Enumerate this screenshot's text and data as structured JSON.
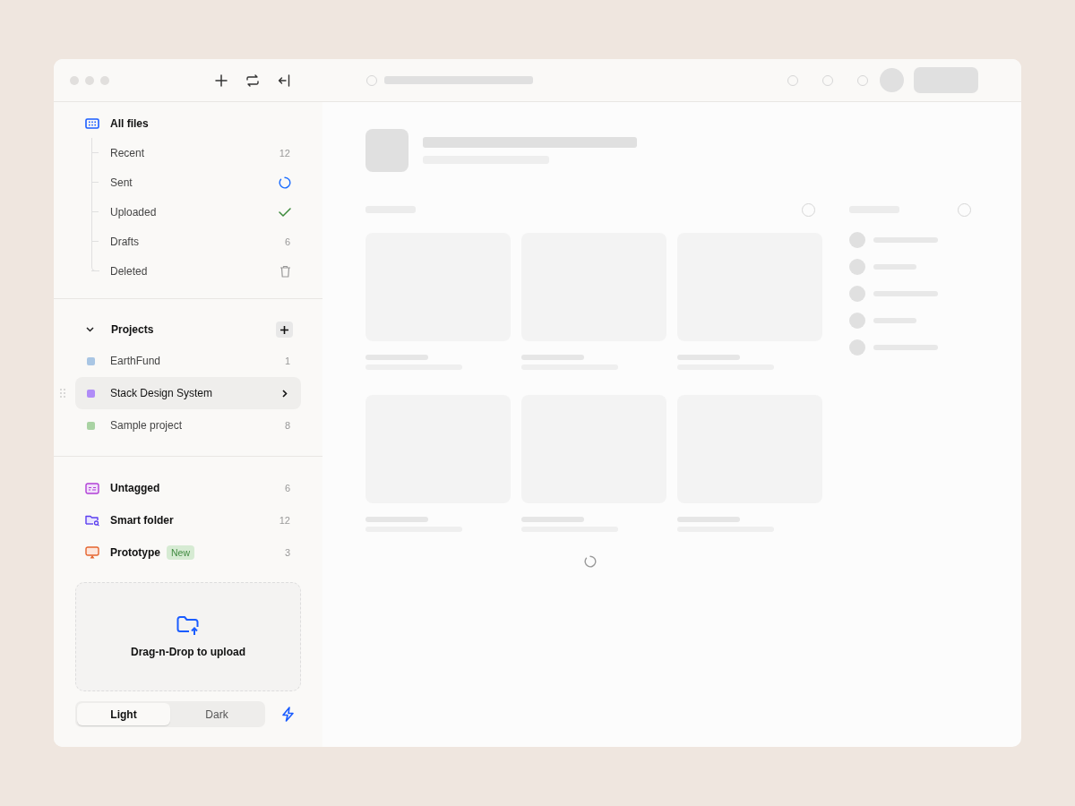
{
  "sidebar": {
    "all_files": {
      "label": "All files"
    },
    "file_items": [
      {
        "label": "Recent",
        "kind": "count",
        "count": "12"
      },
      {
        "label": "Sent",
        "kind": "spinner"
      },
      {
        "label": "Uploaded",
        "kind": "check"
      },
      {
        "label": "Drafts",
        "kind": "count",
        "count": "6"
      },
      {
        "label": "Deleted",
        "kind": "trash"
      }
    ],
    "projects": {
      "label": "Projects",
      "expanded": true,
      "items": [
        {
          "label": "EarthFund",
          "color": "#a9c6e4",
          "count": "1",
          "selected": false
        },
        {
          "label": "Stack Design System",
          "color": "#b08cf7",
          "selected": true
        },
        {
          "label": "Sample project",
          "color": "#a9d3a3",
          "count": "8",
          "selected": false
        }
      ]
    },
    "tags": [
      {
        "label": "Untagged",
        "kind": "untagged",
        "count": "6"
      },
      {
        "label": "Smart folder",
        "kind": "smart",
        "count": "12"
      },
      {
        "label": "Prototype",
        "kind": "prototype",
        "badge": "New",
        "count": "3"
      }
    ],
    "upload": {
      "label": "Drag-n-Drop to upload"
    },
    "theme_toggle": [
      {
        "label": "Light",
        "selected": true
      },
      {
        "label": "Dark",
        "selected": false
      }
    ]
  }
}
